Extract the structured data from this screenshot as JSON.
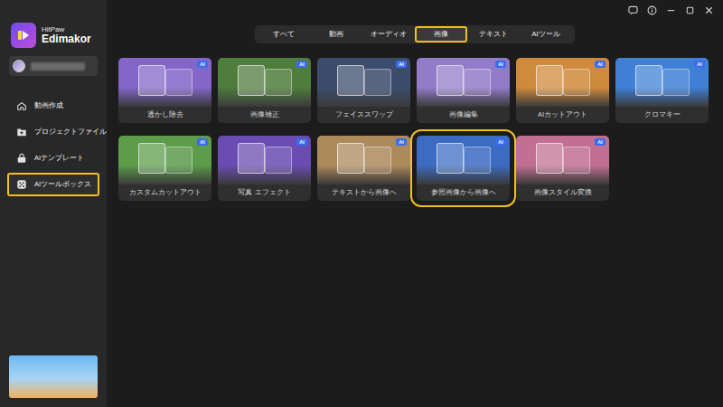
{
  "app": {
    "brand": "HitPaw",
    "product": "Edimakor"
  },
  "sidebar": {
    "items": [
      {
        "label": "動画作成",
        "selected": false
      },
      {
        "label": "プロジェクトファイル",
        "selected": false
      },
      {
        "label": "AIテンプレート",
        "selected": false
      },
      {
        "label": "AIツールボックス",
        "selected": true
      }
    ]
  },
  "tabs": [
    {
      "label": "すべて",
      "selected": false
    },
    {
      "label": "動画",
      "selected": false
    },
    {
      "label": "オーディオ",
      "selected": false
    },
    {
      "label": "画像",
      "selected": true
    },
    {
      "label": "テキスト",
      "selected": false
    },
    {
      "label": "AIツール",
      "selected": false
    }
  ],
  "tools": [
    {
      "label": "透かし除去",
      "badge": "AI",
      "selected": false,
      "color": "#8466c8"
    },
    {
      "label": "画像補正",
      "badge": "AI",
      "selected": false,
      "color": "#4f7d3c"
    },
    {
      "label": "フェイススワップ",
      "badge": "AI",
      "selected": false,
      "color": "#3c4c6c"
    },
    {
      "label": "画像編集",
      "badge": "AI",
      "selected": false,
      "color": "#927cc9"
    },
    {
      "label": "AIカットアウト",
      "badge": "AI",
      "selected": false,
      "color": "#d08a3c"
    },
    {
      "label": "クロマキー",
      "badge": "AI",
      "selected": false,
      "color": "#3f80d6"
    },
    {
      "label": "カスタムカットアウト",
      "badge": "AI",
      "selected": false,
      "color": "#5c9c4a"
    },
    {
      "label": "写真 エフェクト",
      "badge": "AI",
      "selected": false,
      "color": "#6a4cb2"
    },
    {
      "label": "テキストから画像へ",
      "badge": "AI",
      "selected": false,
      "color": "#ad8a5c"
    },
    {
      "label": "参照画像から画像へ",
      "badge": "AI",
      "selected": true,
      "color": "#3c6cc2"
    },
    {
      "label": "画像スタイル変換",
      "badge": "AI",
      "selected": false,
      "color": "#c27092"
    }
  ]
}
